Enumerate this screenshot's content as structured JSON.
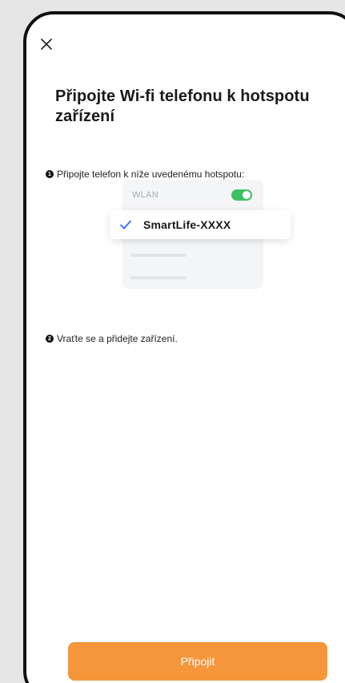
{
  "header": {
    "close_icon": "close-icon",
    "title": "Připojte Wi-fi telefonu k hotspotu zařízení"
  },
  "steps": [
    {
      "number": "1",
      "text": "Připojte telefon k níže uvedenému hotspotu:"
    },
    {
      "number": "2",
      "text": "Vraťte se a přidejte zařízení."
    }
  ],
  "illustration": {
    "wlan_label": "WLAN",
    "wlan_enabled": true,
    "network_name": "SmartLife-XXXX",
    "check_icon": "check-icon",
    "toggle_color": "#3cc063",
    "check_color": "#2f6bff"
  },
  "footer": {
    "connect_label": "Připojit",
    "button_color": "#f5963b"
  }
}
